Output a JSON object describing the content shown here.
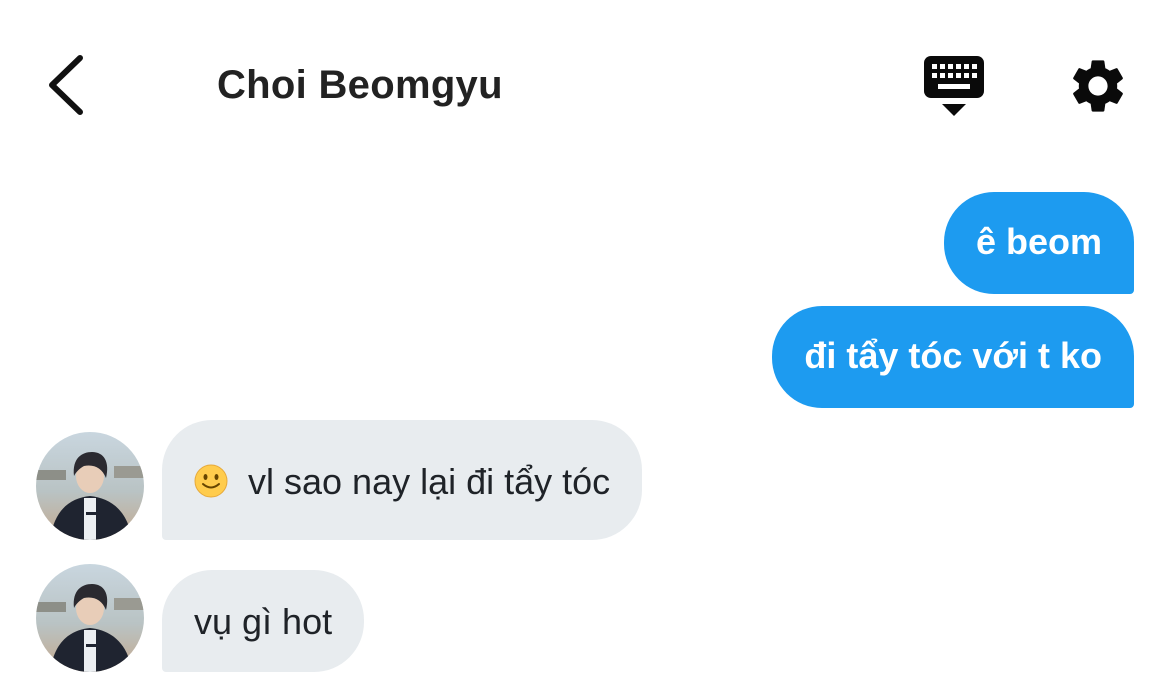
{
  "header": {
    "title": "Choi Beomgyu",
    "back_icon": "chevron-left-icon",
    "keyboard_icon": "keyboard-icon",
    "settings_icon": "gear-icon"
  },
  "messages": [
    {
      "direction": "outgoing",
      "text": "ê beom"
    },
    {
      "direction": "outgoing",
      "text": "đi tẩy tóc với t ko"
    },
    {
      "direction": "incoming",
      "emoji": "slightly-smiling-face-icon",
      "text": "vl sao nay lại đi tẩy tóc"
    },
    {
      "direction": "incoming",
      "text": "vụ gì hot"
    }
  ],
  "colors": {
    "outgoing_bubble": "#1d9bf0",
    "incoming_bubble": "#e8ecef",
    "title_text": "#222222"
  }
}
